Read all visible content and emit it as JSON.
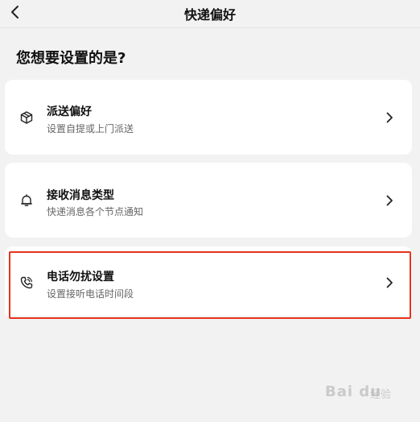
{
  "header": {
    "title": "快递偏好",
    "back_icon": "chevron-left-icon"
  },
  "question": "您想要设置的是?",
  "options": [
    {
      "title": "派送偏好",
      "subtitle": "设置自提或上门派送",
      "icon": "package-icon"
    },
    {
      "title": "接收消息类型",
      "subtitle": "快递消息各个节点通知",
      "icon": "bell-icon"
    },
    {
      "title": "电话勿扰设置",
      "subtitle": "设置接听电话时间段",
      "icon": "phone-icon",
      "highlighted": true
    }
  ],
  "watermark": {
    "brand": "Bai du",
    "suffix": "经验"
  },
  "colors": {
    "background": "#f2f2f2",
    "card": "#ffffff",
    "highlight": "#e8321e"
  }
}
